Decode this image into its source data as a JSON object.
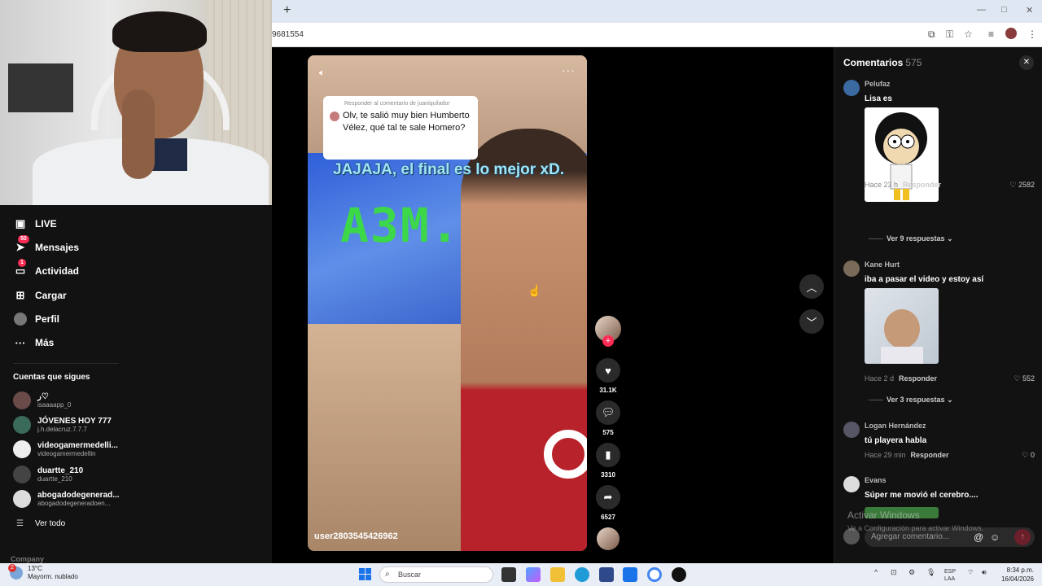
{
  "browser": {
    "url": "9681554",
    "new_tab_glyph": "+"
  },
  "sidebar": {
    "nav": [
      {
        "label": "LIVE",
        "icon": "live-icon",
        "badge": ""
      },
      {
        "label": "Mensajes",
        "icon": "messages-icon",
        "badge": "50"
      },
      {
        "label": "Actividad",
        "icon": "activity-icon",
        "badge": "1"
      },
      {
        "label": "Cargar",
        "icon": "upload-icon",
        "badge": ""
      },
      {
        "label": "Perfil",
        "icon": "profile-icon",
        "badge": ""
      },
      {
        "label": "Más",
        "icon": "more-icon",
        "badge": ""
      }
    ],
    "following_title": "Cuentas que sigues",
    "accounts": [
      {
        "name": "ر♡",
        "handle": "isaaaapp_0"
      },
      {
        "name": "JÓVENES HOY 777",
        "handle": "j.h.delacruz.7.7.7"
      },
      {
        "name": "videogamermedelli...",
        "handle": "videogamermedellin"
      },
      {
        "name": "duartte_210",
        "handle": "duartte_210"
      },
      {
        "name": "abogadodegenerad...",
        "handle": "abogadodegeneradoen..."
      }
    ],
    "see_all": "Ver todo",
    "company": "Company"
  },
  "video": {
    "reply_header": "Responder al comentario de juaniquilador",
    "reply_text": "Olv, te salió muy bien Humberto Vélez, qué tal te sale Homero?",
    "caption": "JAJAJA, el final es lo mejor xD.",
    "tv_text": "A3M.O",
    "username": "user2803545426962"
  },
  "actions": {
    "likes": "31.1K",
    "comments": "575",
    "saves": "3310",
    "shares": "6527"
  },
  "comments": {
    "title": "Comentarios",
    "count": "575",
    "items": [
      {
        "user": "Pelufaz",
        "text": "Lisa es",
        "time": "Hace 23 h",
        "reply": "Responder",
        "likes": "2582",
        "more": "Ver 9 respuestas"
      },
      {
        "user": "Kane Hurt",
        "text": "iba a pasar el video y estoy así",
        "time": "Hace 2 d",
        "reply": "Responder",
        "likes": "552",
        "more": "Ver 3 respuestas"
      },
      {
        "user": "Logan Hernández",
        "text": "tú playera habla",
        "time": "Hace 29 min",
        "reply": "Responder",
        "likes": "0"
      },
      {
        "user": "Evans",
        "text": "Súper me movió el cerebro...."
      }
    ],
    "input_placeholder": "Agregar comentario...",
    "watermark_title": "Activar Windows",
    "watermark_sub": "Ve a Configuración para activar Windows."
  },
  "taskbar": {
    "weather_badge": "2",
    "temp": "13°C",
    "weather": "Mayorm. nublado",
    "search": "Buscar",
    "lang1": "ESP",
    "lang2": "LAA",
    "time": "8:34 p.m.",
    "date": "16/04/2026"
  },
  "colors": {
    "accent": "#fe2c55",
    "panel": "#121212",
    "caption": "#9ee6f6"
  }
}
